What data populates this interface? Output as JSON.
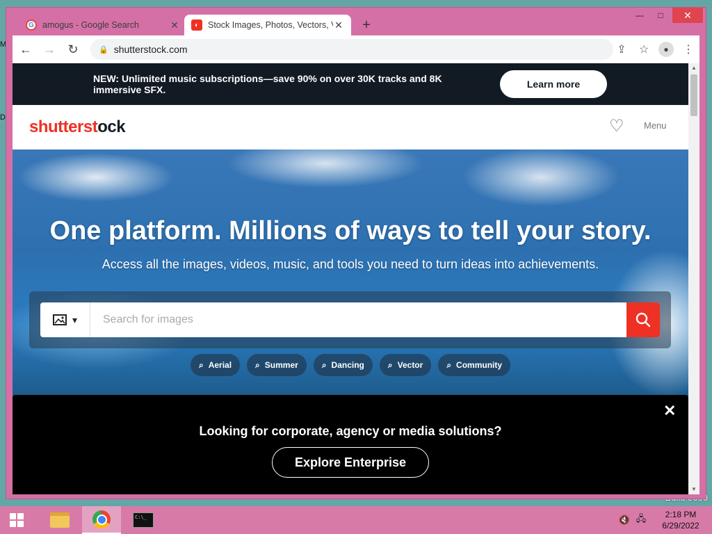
{
  "desktop": {
    "edge_chars": [
      "M",
      "D"
    ],
    "watermark": "Build 9600"
  },
  "browser": {
    "tabs": [
      {
        "title": "amogus - Google Search",
        "favicon": "google-icon"
      },
      {
        "title": "Stock Images, Photos, Vectors, V",
        "favicon": "shutterstock-icon",
        "active": true
      }
    ],
    "new_tab": "+",
    "window_controls": {
      "minimize": "—",
      "maximize": "□",
      "close": "✕"
    },
    "url": "shutterstock.com",
    "nav": {
      "back": "←",
      "forward": "→",
      "reload": "↻"
    }
  },
  "page": {
    "promo": {
      "text": "NEW: Unlimited music subscriptions—save 90% on over 30K tracks and 8K immersive SFX.",
      "button": "Learn more"
    },
    "header": {
      "logo_part1": "shutterst",
      "logo_accent": "o",
      "logo_part2": "ck",
      "menu": "Menu"
    },
    "hero": {
      "title": "One platform. Millions of ways to tell your story.",
      "subtitle": "Access all the images, videos, music, and tools you need to turn ideas into achievements.",
      "search_placeholder": "Search for images",
      "chips": [
        "Aerial",
        "Summer",
        "Dancing",
        "Vector",
        "Community"
      ]
    },
    "enterprise": {
      "question": "Looking for corporate, agency or media solutions?",
      "button": "Explore Enterprise",
      "close": "✕"
    }
  },
  "taskbar": {
    "time": "2:18 PM",
    "date": "6/29/2022"
  },
  "colors": {
    "accent": "#ee3124",
    "promo_bg": "#121b24",
    "window_frame": "#d570a6"
  }
}
